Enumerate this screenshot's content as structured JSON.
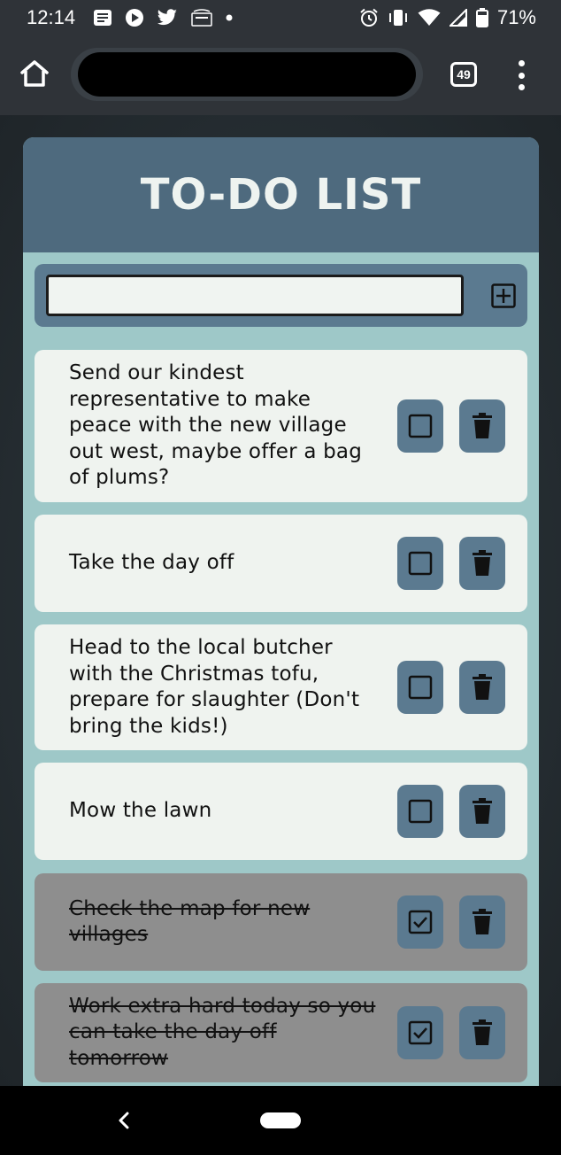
{
  "status_bar": {
    "time": "12:14",
    "battery": "71%",
    "left_icons": [
      "news-icon",
      "play-icon",
      "twitter-icon",
      "amazon-icon",
      "dot-icon"
    ],
    "right_icons": [
      "alarm-icon",
      "vibrate-icon",
      "wifi-icon",
      "signal-icon",
      "battery-icon"
    ]
  },
  "browser": {
    "tab_count": "49",
    "icons": {
      "home": "home-icon",
      "menu": "more-vert-icon"
    }
  },
  "app": {
    "title": "TO-DO LIST",
    "input": {
      "value": "",
      "placeholder": ""
    },
    "add_icon": "plus-square-icon",
    "colors": {
      "header": "#4e6a7e",
      "panel": "#9ec8c8",
      "button": "#5b7a90",
      "item": "#eff3ef",
      "item_done": "#8e8e8e"
    },
    "todos": [
      {
        "text": "Send our kindest representative to make peace with the new village out west, maybe offer a bag of plums?",
        "done": false
      },
      {
        "text": "Take the day off",
        "done": false
      },
      {
        "text": "Head to the local butcher with the Christmas tofu, prepare for slaughter (Don't bring the kids!)",
        "done": false
      },
      {
        "text": "Mow the lawn",
        "done": false
      },
      {
        "text": "Check the map for new villages",
        "done": true
      },
      {
        "text": "Work extra hard today so you can take the day off tomorrow",
        "done": true
      }
    ]
  },
  "nav": {
    "icons": [
      "back-icon",
      "home-pill"
    ]
  }
}
